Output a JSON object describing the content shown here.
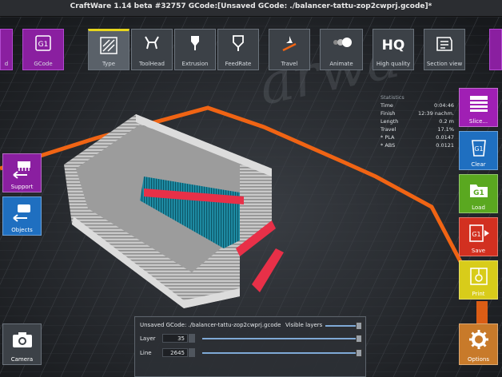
{
  "window": {
    "title": "CraftWare 1.14 beta #32757  GCode:[Unsaved GCode: ./balancer-tattu-zop2cwprj.gcode]*"
  },
  "toolbar": {
    "left_partial_label": "d",
    "gcode_label": "GCode",
    "type_label": "Type",
    "toolhead_label": "ToolHead",
    "extrusion_label": "Extrusion",
    "feedrate_label": "FeedRate",
    "travel_label": "Travel",
    "animate_label": "Animate",
    "hq_text": "HQ",
    "high_quality_label": "High quality",
    "section_view_label": "Section view"
  },
  "left_panel": {
    "support_label": "Support",
    "objects_label": "Objects",
    "camera_label": "Camera"
  },
  "right_panel": {
    "slice_label": "Slice...",
    "clear_label": "Clear",
    "load_label": "Load",
    "save_label": "Save",
    "print_label": "Print",
    "options_label": "Options",
    "g1": "G1"
  },
  "statistics": {
    "title": "Statistics",
    "rows": [
      {
        "label": "Time",
        "value": "0:04:46"
      },
      {
        "label": "Finish",
        "value": "12:39 nachm."
      },
      {
        "label": "Length",
        "value": "0.2 m"
      },
      {
        "label": "Travel",
        "value": "17.1%"
      },
      {
        "label": "* PLA",
        "value": "0.0147"
      },
      {
        "label": "* ABS",
        "value": "0.0121"
      }
    ]
  },
  "bottom_panel": {
    "file": "Unsaved GCode: ./balancer-tattu-zop2cwprj.gcode",
    "visible_layers_label": "Visible layers",
    "layer_label": "Layer",
    "layer_value": "35",
    "line_label": "Line",
    "line_value": "2645"
  },
  "colors": {
    "accent_orange": "#f06414",
    "purple": "#8a1fa0",
    "blue": "#1f6fc0",
    "green": "#5aa820",
    "red": "#d23020",
    "yellow": "#d8cc1a"
  }
}
